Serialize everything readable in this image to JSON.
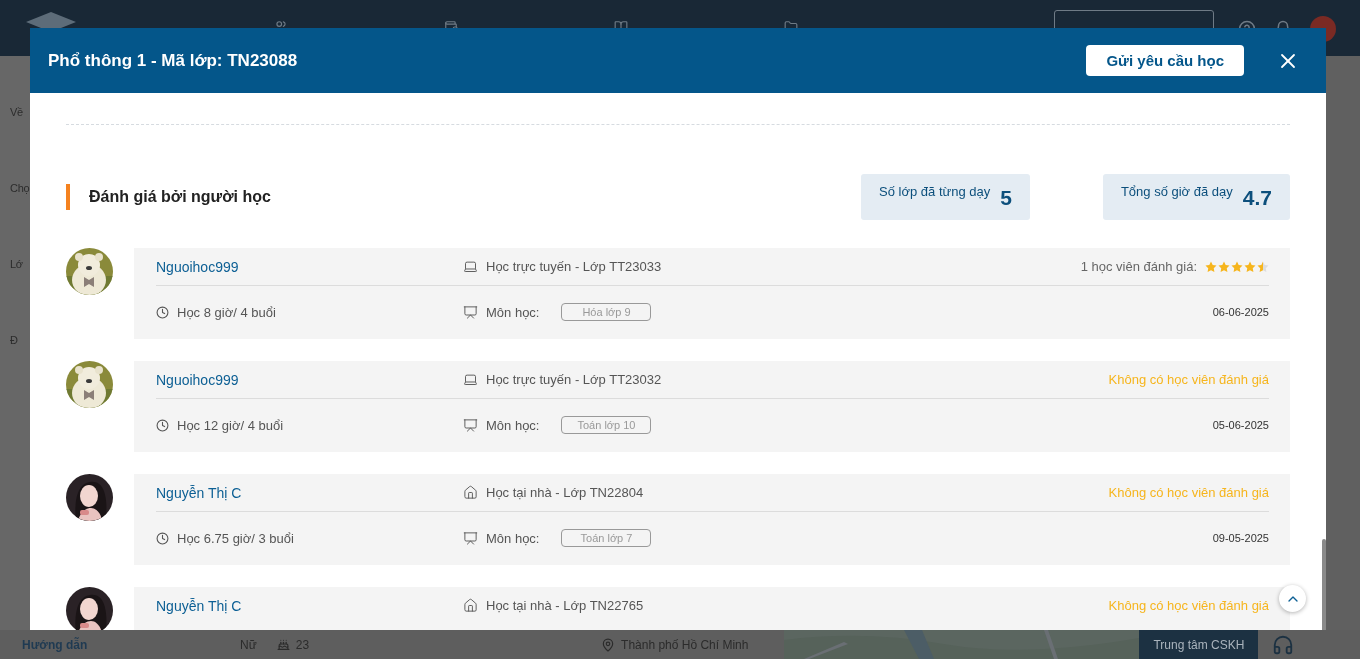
{
  "background": {
    "side_items": [
      "Về",
      "Chọ",
      "Lớ",
      "Đ"
    ],
    "footer": {
      "guide": "Hướng dẫn",
      "gender": "Nữ",
      "age": "23",
      "city": "Thành phố Hồ Chí Minh",
      "support": "Trung tâm CSKH"
    }
  },
  "modal": {
    "title": "Phổ thông 1 - Mã lớp: TN23088",
    "request_button": "Gửi yêu cầu học",
    "section_title": "Đánh giá bởi người học",
    "stats": [
      {
        "label": "Số lớp đã từng dạy",
        "value": "5"
      },
      {
        "label": "Tổng số giờ đã dạy",
        "value": "4.7"
      }
    ],
    "reviews": [
      {
        "kind": "online",
        "name": "Nguoihoc999",
        "class": "Học trực tuyến - Lớp TT23033",
        "rating_label": "1 học viên đánh giá:",
        "stars": 4.5,
        "hours": "Học 8 giờ/ 4 buổi",
        "subject_label": "Môn học:",
        "subject": "Hóa lớp 9",
        "date": "06-06-2025"
      },
      {
        "kind": "online",
        "name": "Nguoihoc999",
        "class": "Học trực tuyến - Lớp TT23032",
        "rating_label": "Không có học viên đánh giá",
        "hours": "Học 12 giờ/ 4 buổi",
        "subject_label": "Môn học:",
        "subject": "Toán lớp 10",
        "date": "05-06-2025"
      },
      {
        "kind": "home",
        "name": "Nguyễn Thị C",
        "class": "Học tại nhà - Lớp TN22804",
        "rating_label": "Không có học viên đánh giá",
        "hours": "Học 6.75 giờ/ 3 buổi",
        "subject_label": "Môn học:",
        "subject": "Toán lớp 7",
        "date": "09-05-2025"
      },
      {
        "kind": "home",
        "name": "Nguyễn Thị C",
        "class": "Học tại nhà - Lớp TN22765",
        "rating_label": "Không có học viên đánh giá"
      }
    ]
  }
}
